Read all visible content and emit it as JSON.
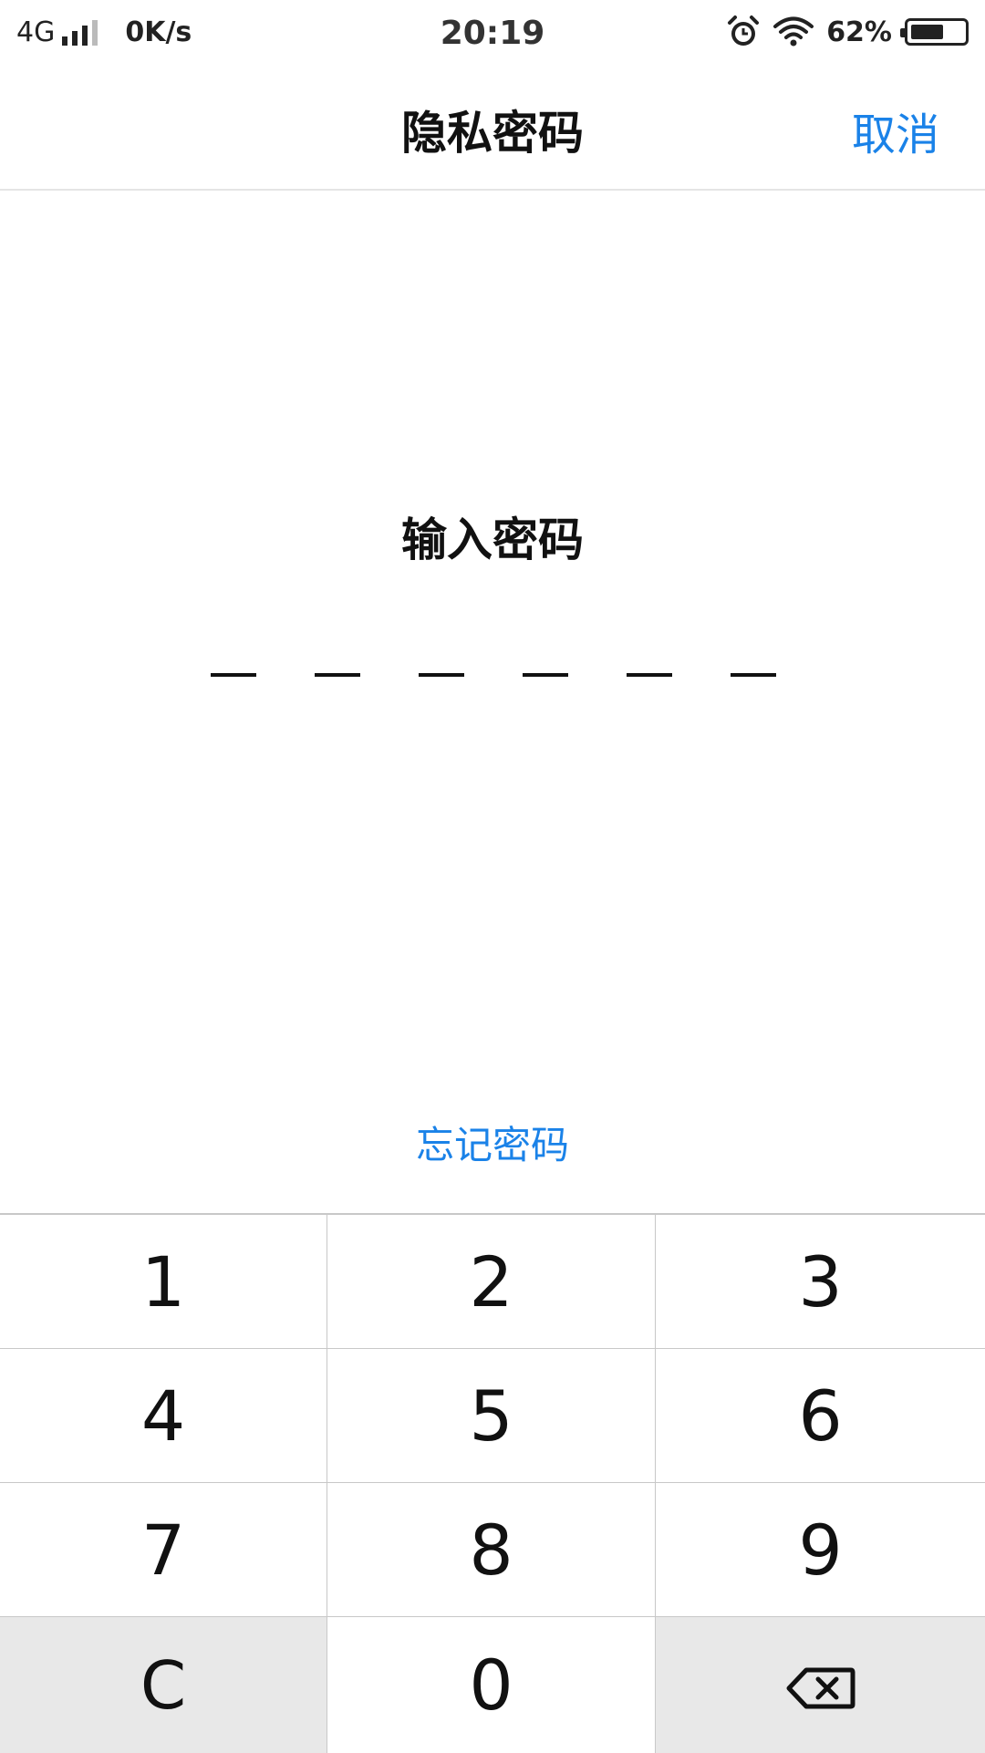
{
  "status_bar": {
    "network": "4G",
    "speed": "0K/s",
    "time": "20:19",
    "battery_percent": "62%",
    "battery_level": 0.62,
    "icons": [
      "signal-icon",
      "alarm-icon",
      "wifi-icon",
      "battery-icon"
    ]
  },
  "header": {
    "title": "隐私密码",
    "cancel_label": "取消"
  },
  "prompt": {
    "title": "输入密码",
    "pin_length": 6,
    "pin_entered": 0
  },
  "forgot_label": "忘记密码",
  "keypad": {
    "keys": [
      "1",
      "2",
      "3",
      "4",
      "5",
      "6",
      "7",
      "8",
      "9",
      "C",
      "0"
    ],
    "backspace_icon": "backspace-icon"
  },
  "colors": {
    "accent": "#1a82e8",
    "text": "#111111",
    "key_gray": "#e8e8e8",
    "divider": "#c8c8c8"
  }
}
